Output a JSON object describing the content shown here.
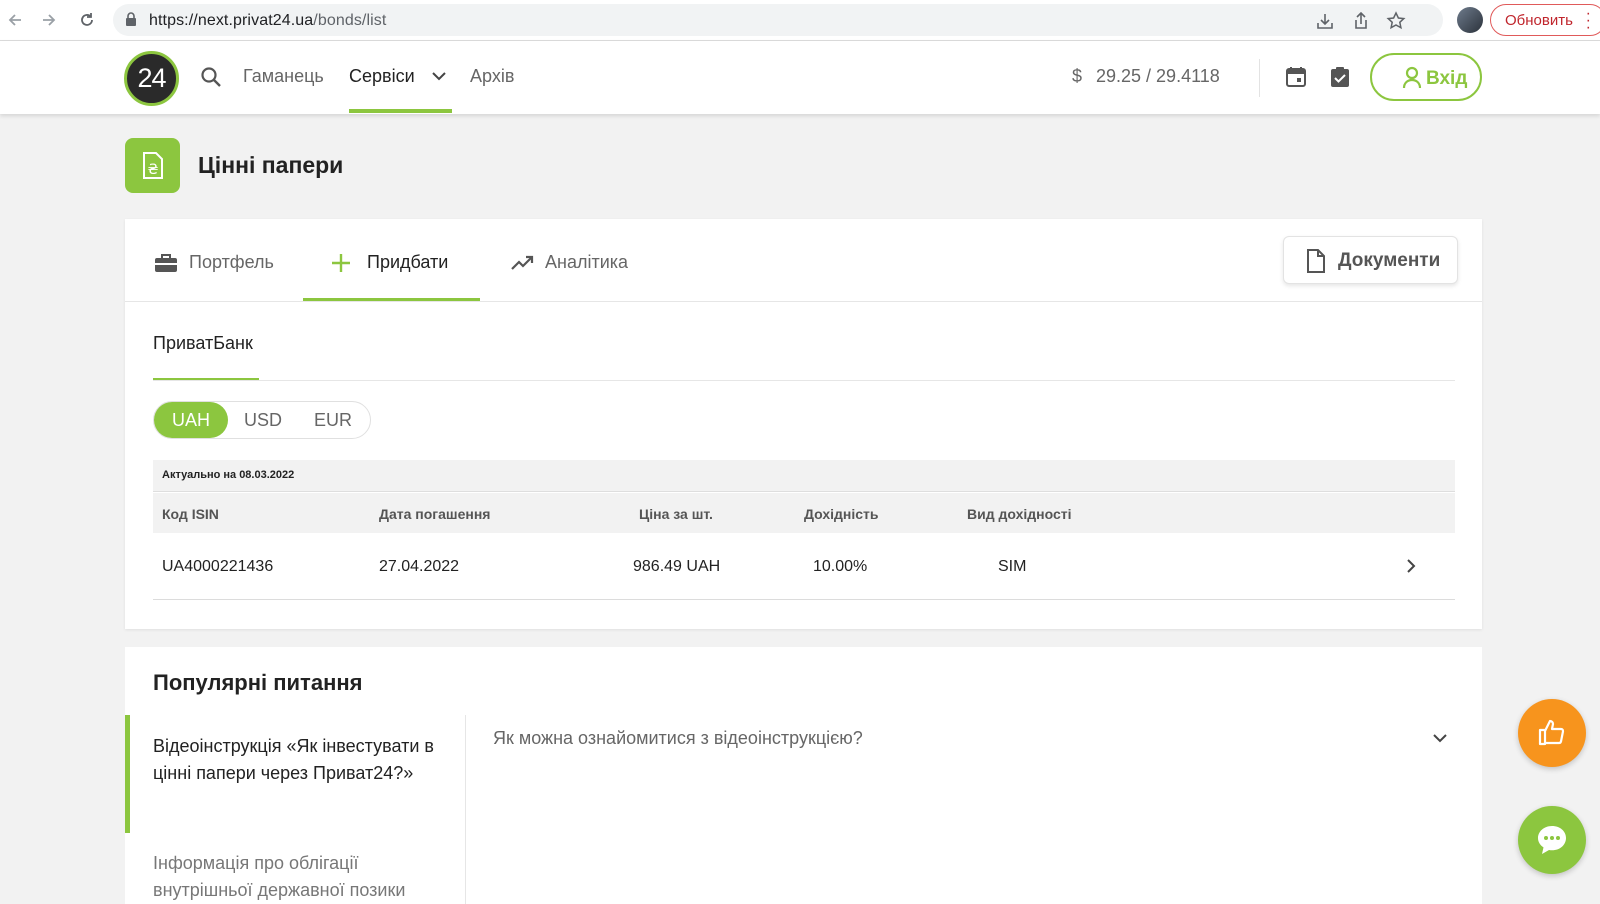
{
  "browser": {
    "url_host": "https://next.privat24.ua",
    "url_path": "/bonds/list",
    "update_label": "Обновить"
  },
  "header": {
    "logo_text": "24",
    "nav": [
      "Гаманець",
      "Сервіси",
      "Архів"
    ],
    "rate_currency": "$",
    "rate": "29.25 / 29.4118",
    "login_label": "Вхід"
  },
  "page": {
    "title": "Цінні папери"
  },
  "tabs": {
    "portfolio": "Портфель",
    "buy": "Придбати",
    "analytics": "Аналітика",
    "documents": "Документи"
  },
  "bank": {
    "name": "ПриватБанк"
  },
  "currencies": {
    "items": [
      "UAH",
      "USD",
      "EUR"
    ],
    "selected": "UAH"
  },
  "table": {
    "actual_label": "Актуально на 08.03.2022",
    "columns": [
      "Код ISIN",
      "Дата погашення",
      "Ціна за шт.",
      "Дохідність",
      "Вид дохідності"
    ],
    "rows": [
      [
        "UA4000221436",
        "27.04.2022",
        "986.49 UAH",
        "10.00%",
        "SIM"
      ]
    ]
  },
  "faq": {
    "title": "Популярні питання",
    "items": [
      "Відеоінструкція «Як інвестувати в цінні папери через Приват24?»",
      "Інформація про облігації внутрішньої державної позики"
    ],
    "question": "Як можна ознайомитися з відеоінструкцією?"
  },
  "colors": {
    "brand_green": "#8cc63f",
    "like_orange": "#f7941d"
  },
  "icons": [
    "back-icon",
    "forward-icon",
    "reload-icon",
    "lock-icon",
    "download-icon",
    "share-icon",
    "star-icon",
    "search-icon",
    "chevron-down-icon",
    "calendar-icon",
    "clipboard-check-icon",
    "user-icon",
    "document-hryvnia-icon",
    "briefcase-icon",
    "plus-icon",
    "trending-up-icon",
    "document-icon",
    "chevron-right-icon",
    "thumbs-up-icon",
    "chat-icon"
  ]
}
